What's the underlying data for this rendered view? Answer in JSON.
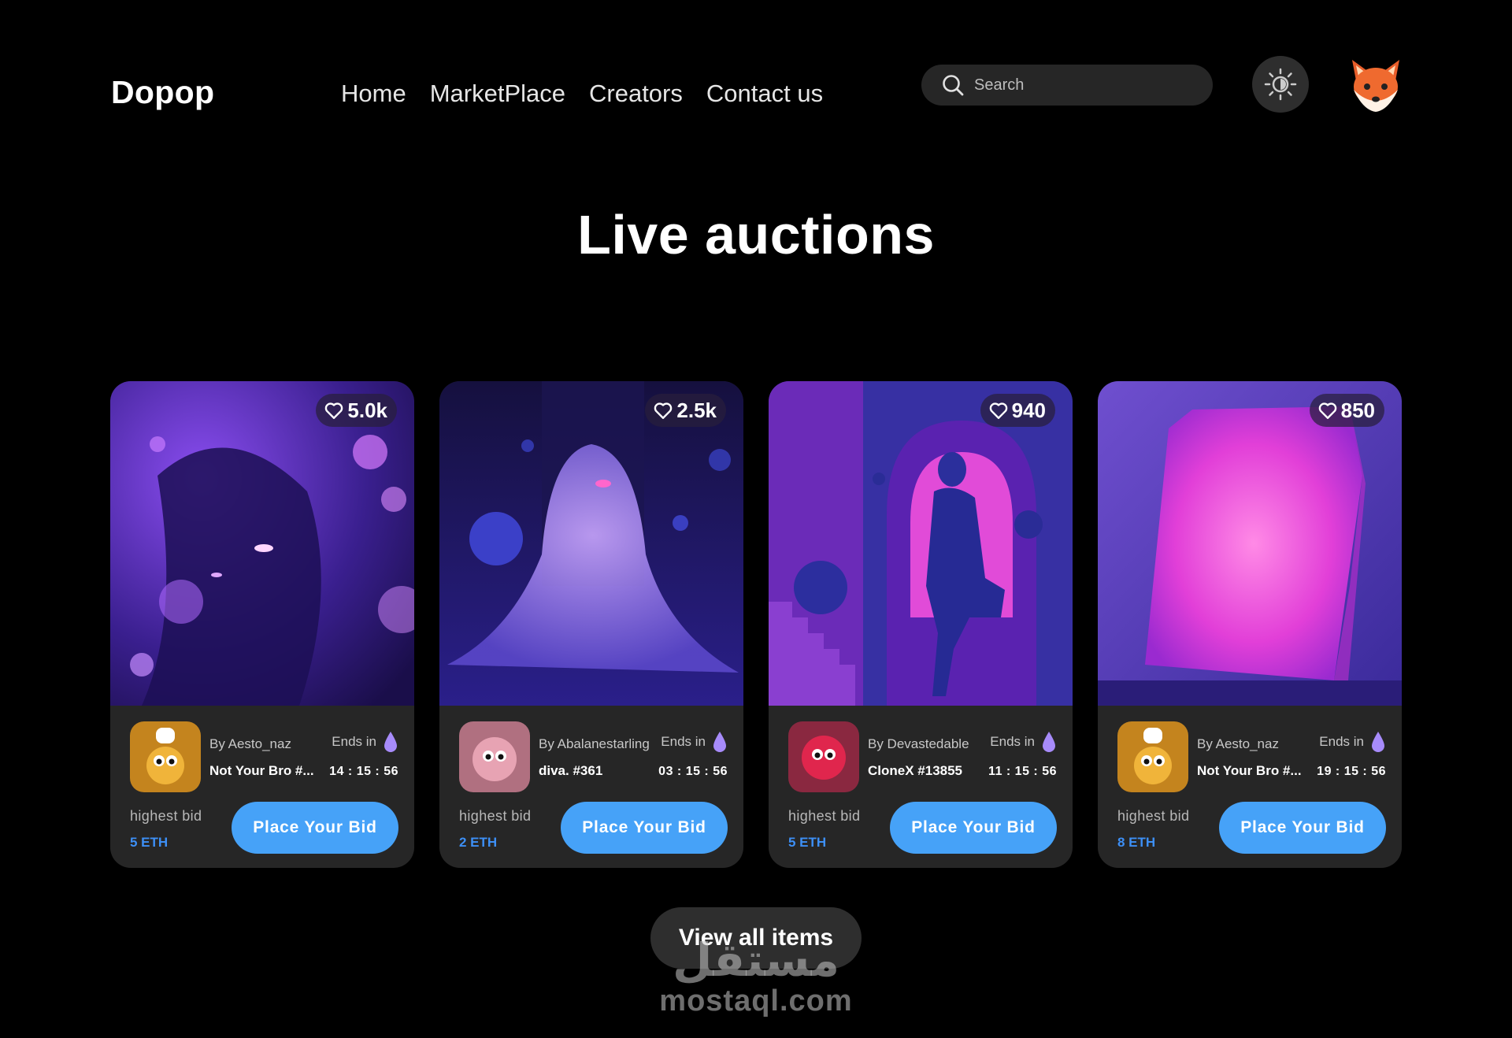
{
  "header": {
    "logo": "Dopop",
    "nav": [
      "Home",
      "MarketPlace",
      "Creators",
      "Contact us"
    ],
    "search_placeholder": "Search",
    "theme_icon": "sun-icon",
    "avatar_icon": "fox-avatar"
  },
  "section": {
    "title": "Live auctions"
  },
  "cards": [
    {
      "likes": "5.0k",
      "creator": "By Aesto_naz",
      "item": "Not Your Bro #...",
      "ends_label": "Ends in",
      "time": "14 : 15 : 56",
      "bid_label": "highest bid",
      "bid": "5 ETH",
      "button": "Place Your Bid"
    },
    {
      "likes": "2.5k",
      "creator": "By Abalanestarling",
      "item": "diva. #361",
      "ends_label": "Ends in",
      "time": "03 : 15 : 56",
      "bid_label": "highest bid",
      "bid": "2 ETH",
      "button": "Place Your Bid"
    },
    {
      "likes": "940",
      "creator": "By Devastedable",
      "item": "CloneX #13855",
      "ends_label": "Ends in",
      "time": "11 : 15 : 56",
      "bid_label": "highest bid",
      "bid": "5 ETH",
      "button": "Place Your Bid"
    },
    {
      "likes": "850",
      "creator": "By Aesto_naz",
      "item": "Not Your Bro #...",
      "ends_label": "Ends in",
      "time": "19 : 15 : 56",
      "bid_label": "highest bid",
      "bid": "8 ETH",
      "button": "Place Your Bid"
    }
  ],
  "view_all": "View all items",
  "watermark": {
    "arabic": "مستقل",
    "latin": "mostaql.com"
  },
  "colors": {
    "accent": "#46a2f8",
    "eth": "#3d8ff5",
    "card_bg": "#262626",
    "page_bg": "#000000"
  }
}
